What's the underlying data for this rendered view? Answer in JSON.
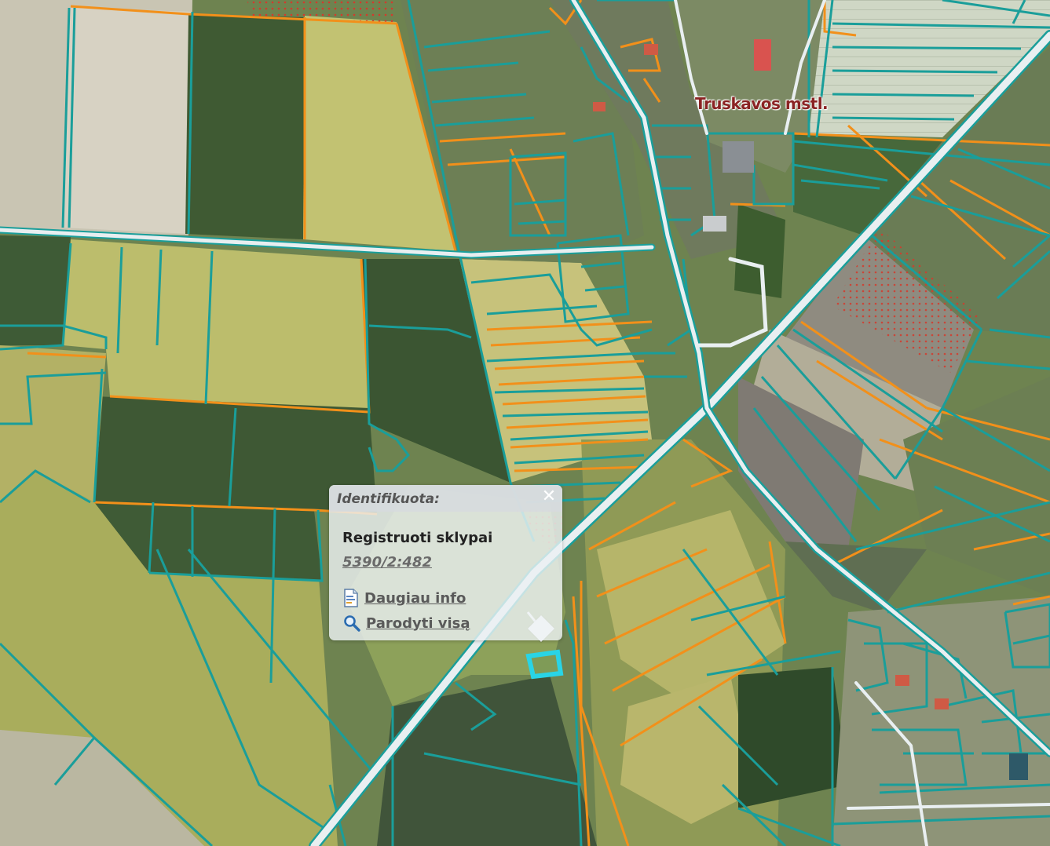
{
  "map": {
    "place_label": "Truskavos mstl.",
    "colors": {
      "parcel_registered": "#1a9e9a",
      "parcel_planned": "#f2901a",
      "road": "#e8eef0",
      "restricted_fill": "#c0392b",
      "highlight": "#29d4e6"
    }
  },
  "popup": {
    "title": "Identifikuota:",
    "close_icon": "close-icon",
    "layer_title": "Registruoti sklypai",
    "parcel_id": "5390/2:482",
    "more_info_label": "Daugiau info",
    "more_info_icon": "document-info-icon",
    "show_all_label": "Parodyti visą",
    "show_all_icon": "magnifier-icon"
  }
}
